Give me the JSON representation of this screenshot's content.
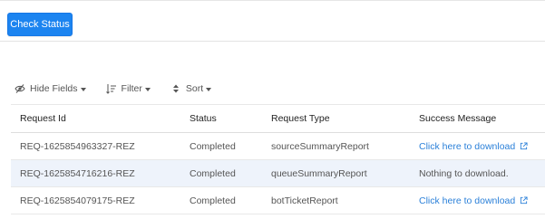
{
  "actions": {
    "check_status_label": "Check Status"
  },
  "toolbar": {
    "hide_fields_label": "Hide Fields",
    "filter_label": "Filter",
    "sort_label": "Sort"
  },
  "table": {
    "headers": [
      "Request Id",
      "Status",
      "Request Type",
      "Success Message"
    ],
    "rows": [
      {
        "id": "REQ-1625854963327-REZ",
        "status": "Completed",
        "type": "sourceSummaryReport",
        "message": "Click here to download",
        "link": true
      },
      {
        "id": "REQ-1625854716216-REZ",
        "status": "Completed",
        "type": "queueSummaryReport",
        "message": "Nothing to download.",
        "link": false
      },
      {
        "id": "REQ-1625854079175-REZ",
        "status": "Completed",
        "type": "botTicketReport",
        "message": "Click here to download",
        "link": true
      }
    ]
  },
  "colors": {
    "primary": "#1c84f0",
    "link": "#2b80d9",
    "alt_row": "#eef3fb"
  },
  "icons": [
    "eye-slash-icon",
    "sort-lines-icon",
    "sort-arrows-icon",
    "external-link-icon"
  ]
}
